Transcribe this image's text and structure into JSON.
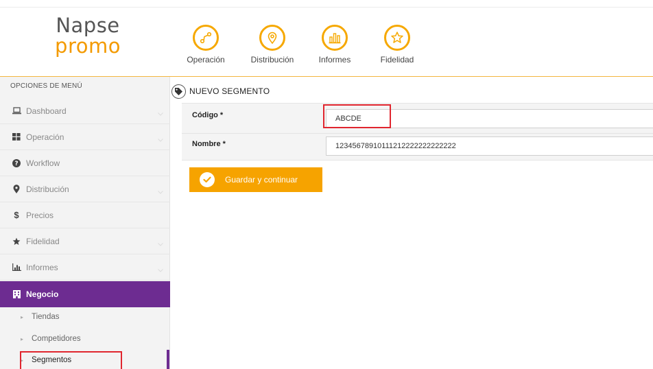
{
  "header": {
    "logo_line1": "Napse",
    "logo_line2": "promo",
    "nav": [
      {
        "label": "Operación",
        "icon": "route-icon"
      },
      {
        "label": "Distribución",
        "icon": "location-pin-icon"
      },
      {
        "label": "Informes",
        "icon": "bar-chart-icon"
      },
      {
        "label": "Fidelidad",
        "icon": "star-icon"
      }
    ]
  },
  "sidebar": {
    "title": "OPCIONES DE MENÚ",
    "items": [
      {
        "label": "Dashboard",
        "icon": "laptop-icon"
      },
      {
        "label": "Operación",
        "icon": "grid-icon"
      },
      {
        "label": "Workflow",
        "icon": "question-icon"
      },
      {
        "label": "Distribución",
        "icon": "map-marker-icon"
      },
      {
        "label": "Precios",
        "icon": "dollar-icon"
      },
      {
        "label": "Fidelidad",
        "icon": "star-icon"
      },
      {
        "label": "Informes",
        "icon": "bar-chart-icon"
      },
      {
        "label": "Negocio",
        "icon": "building-icon"
      }
    ],
    "subitems": [
      {
        "label": "Tiendas"
      },
      {
        "label": "Competidores"
      },
      {
        "label": "Segmentos"
      }
    ]
  },
  "content": {
    "title": "NUEVO SEGMENTO",
    "fields": {
      "codigo_label": "Código *",
      "codigo_value": "ABCDE",
      "nombre_label": "Nombre *",
      "nombre_value": "12345678910111212222222222222"
    },
    "save_label": "Guardar y continuar"
  },
  "colors": {
    "accent": "#f6a800",
    "brand_purple": "#6d2c91",
    "highlight_red": "#e0252e"
  }
}
